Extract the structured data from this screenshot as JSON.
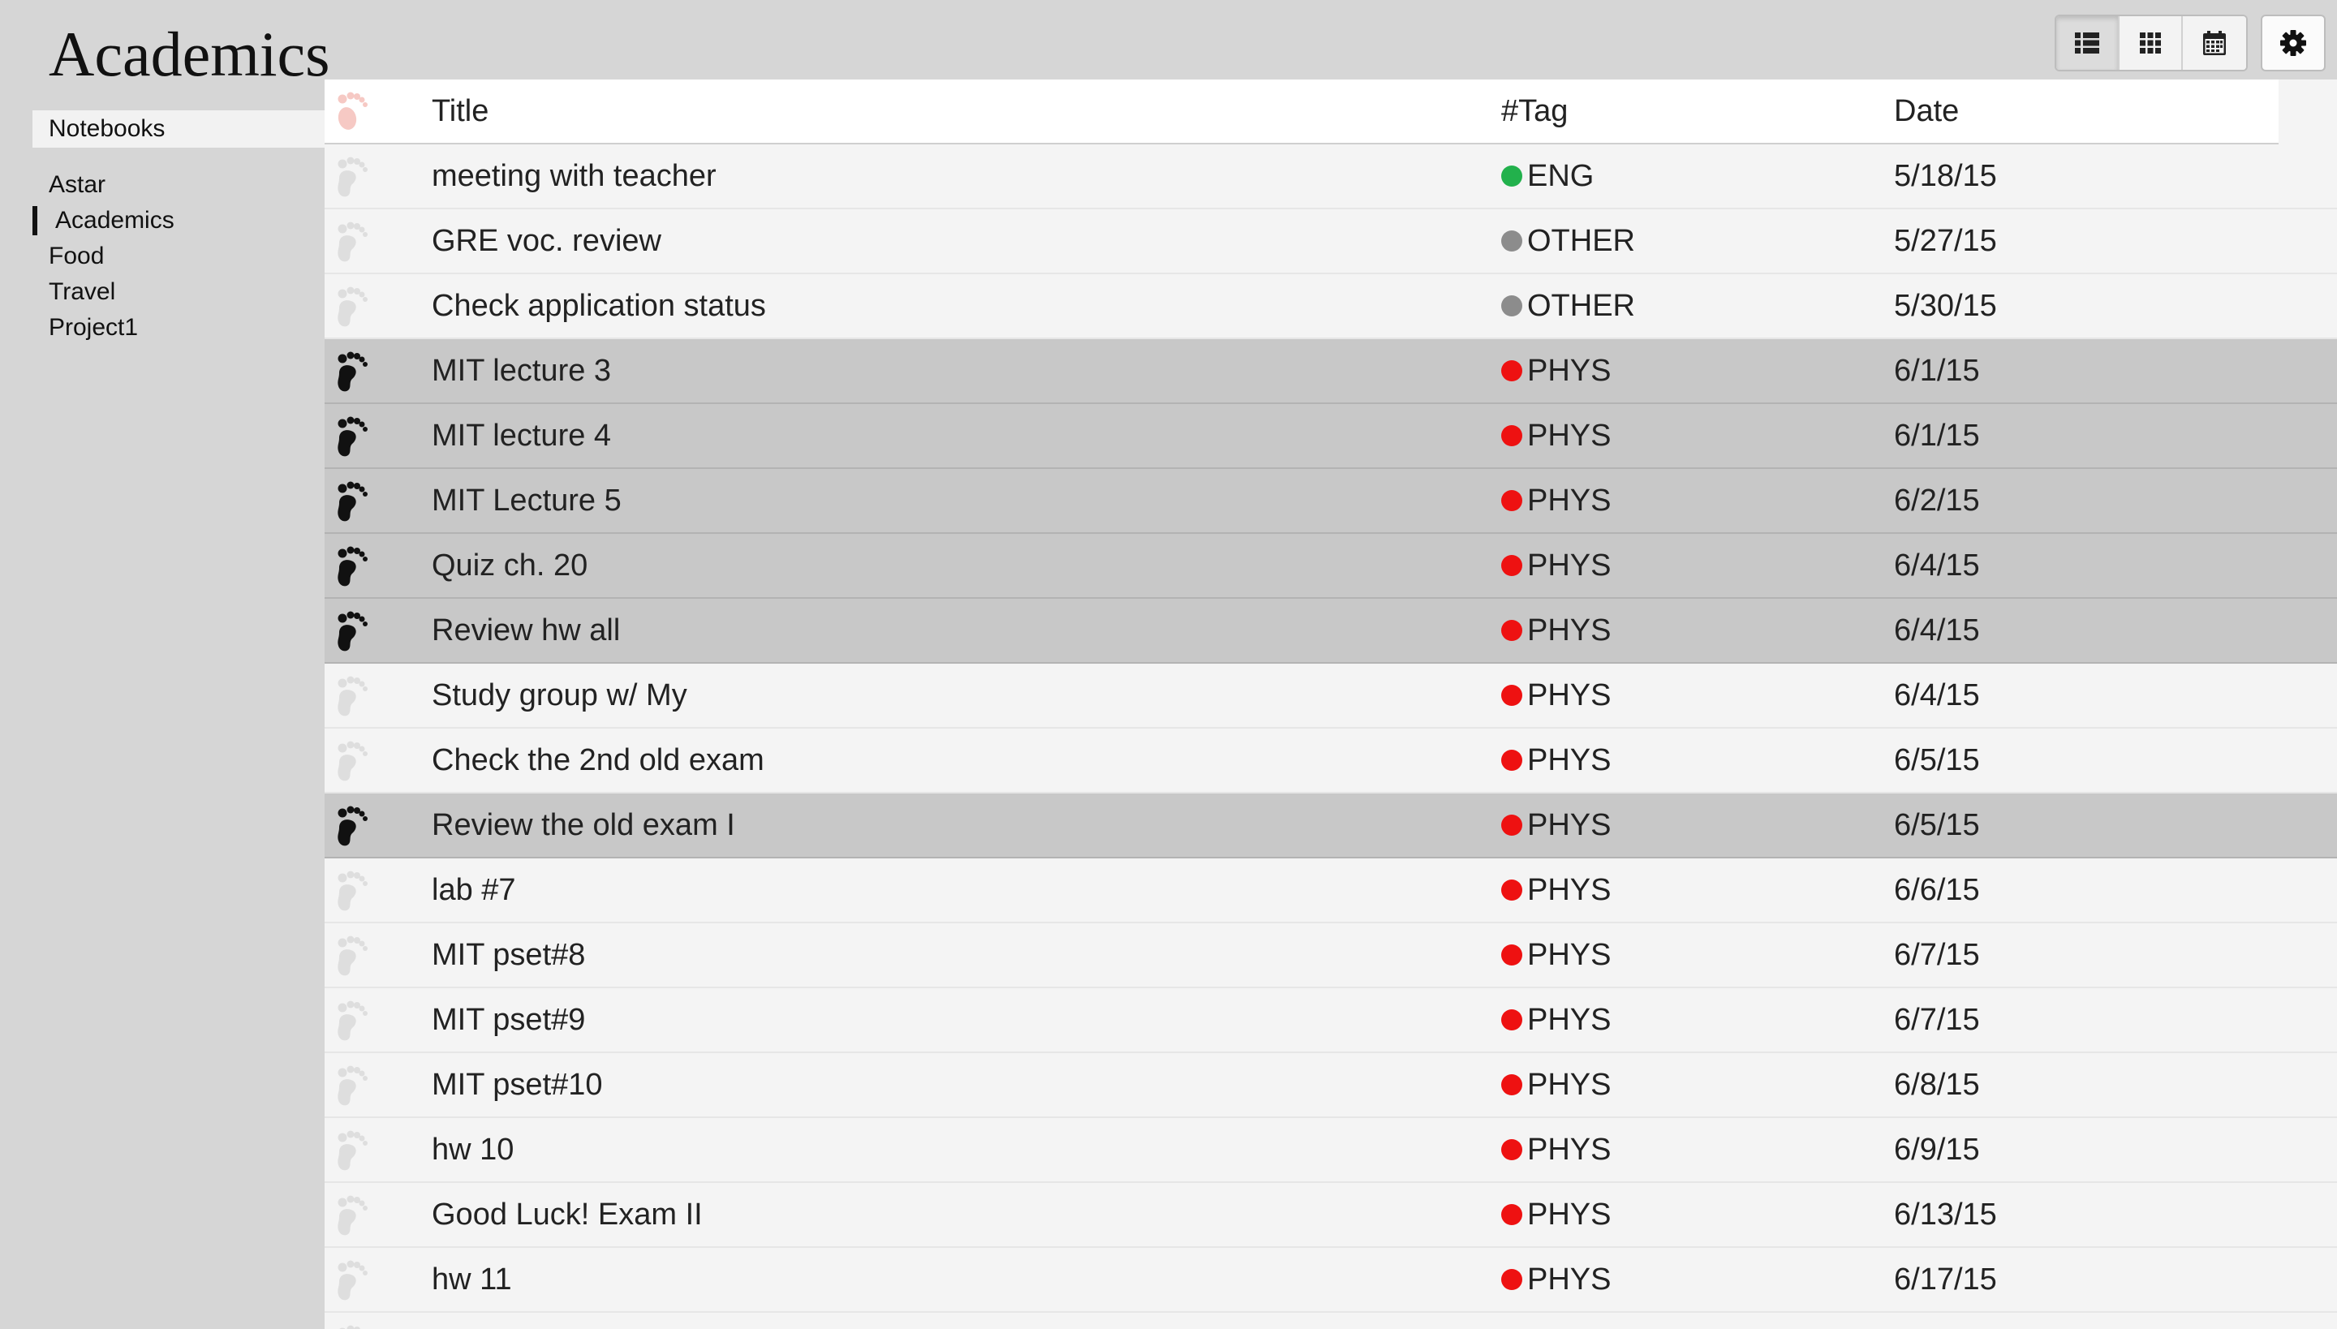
{
  "page": {
    "title": "Academics"
  },
  "sidebar": {
    "heading": "Notebooks",
    "items": [
      {
        "label": "Astar",
        "active": false
      },
      {
        "label": "Academics",
        "active": true
      },
      {
        "label": "Food",
        "active": false
      },
      {
        "label": "Travel",
        "active": false
      },
      {
        "label": "Project1",
        "active": false
      }
    ]
  },
  "toolbar": {
    "views": [
      {
        "icon": "list-view-icon",
        "active": true
      },
      {
        "icon": "grid-view-icon",
        "active": false
      },
      {
        "icon": "calendar-view-icon",
        "active": false
      }
    ],
    "settings_icon": "gear-icon"
  },
  "table": {
    "columns": {
      "icon": "",
      "title": "Title",
      "tag": "#Tag",
      "date": "Date"
    },
    "tag_colors": {
      "ENG": "#22b14c",
      "OTHER": "#8c8c8c",
      "PHYS": "#ee1111"
    },
    "rows": [
      {
        "title": "meeting with teacher",
        "tag": "ENG",
        "date": "5/18/15",
        "done": false
      },
      {
        "title": "GRE voc. review",
        "tag": "OTHER",
        "date": "5/27/15",
        "done": false
      },
      {
        "title": "Check application status",
        "tag": "OTHER",
        "date": "5/30/15",
        "done": false
      },
      {
        "title": "MIT lecture 3",
        "tag": "PHYS",
        "date": "6/1/15",
        "done": true
      },
      {
        "title": "MIT lecture 4",
        "tag": "PHYS",
        "date": "6/1/15",
        "done": true
      },
      {
        "title": "MIT Lecture 5",
        "tag": "PHYS",
        "date": "6/2/15",
        "done": true
      },
      {
        "title": "Quiz ch. 20",
        "tag": "PHYS",
        "date": "6/4/15",
        "done": true
      },
      {
        "title": "Review hw all",
        "tag": "PHYS",
        "date": "6/4/15",
        "done": true
      },
      {
        "title": "Study group w/ My",
        "tag": "PHYS",
        "date": "6/4/15",
        "done": false
      },
      {
        "title": "Check the 2nd old exam",
        "tag": "PHYS",
        "date": "6/5/15",
        "done": false
      },
      {
        "title": "Review the old exam I",
        "tag": "PHYS",
        "date": "6/5/15",
        "done": true
      },
      {
        "title": "lab #7",
        "tag": "PHYS",
        "date": "6/6/15",
        "done": false
      },
      {
        "title": "MIT pset#8",
        "tag": "PHYS",
        "date": "6/7/15",
        "done": false
      },
      {
        "title": "MIT pset#9",
        "tag": "PHYS",
        "date": "6/7/15",
        "done": false
      },
      {
        "title": "MIT pset#10",
        "tag": "PHYS",
        "date": "6/8/15",
        "done": false
      },
      {
        "title": "hw 10",
        "tag": "PHYS",
        "date": "6/9/15",
        "done": false
      },
      {
        "title": "Good Luck! Exam II",
        "tag": "PHYS",
        "date": "6/13/15",
        "done": false
      },
      {
        "title": "hw 11",
        "tag": "PHYS",
        "date": "6/17/15",
        "done": false
      },
      {
        "title": "",
        "tag": "",
        "date": "",
        "done": false
      }
    ]
  }
}
